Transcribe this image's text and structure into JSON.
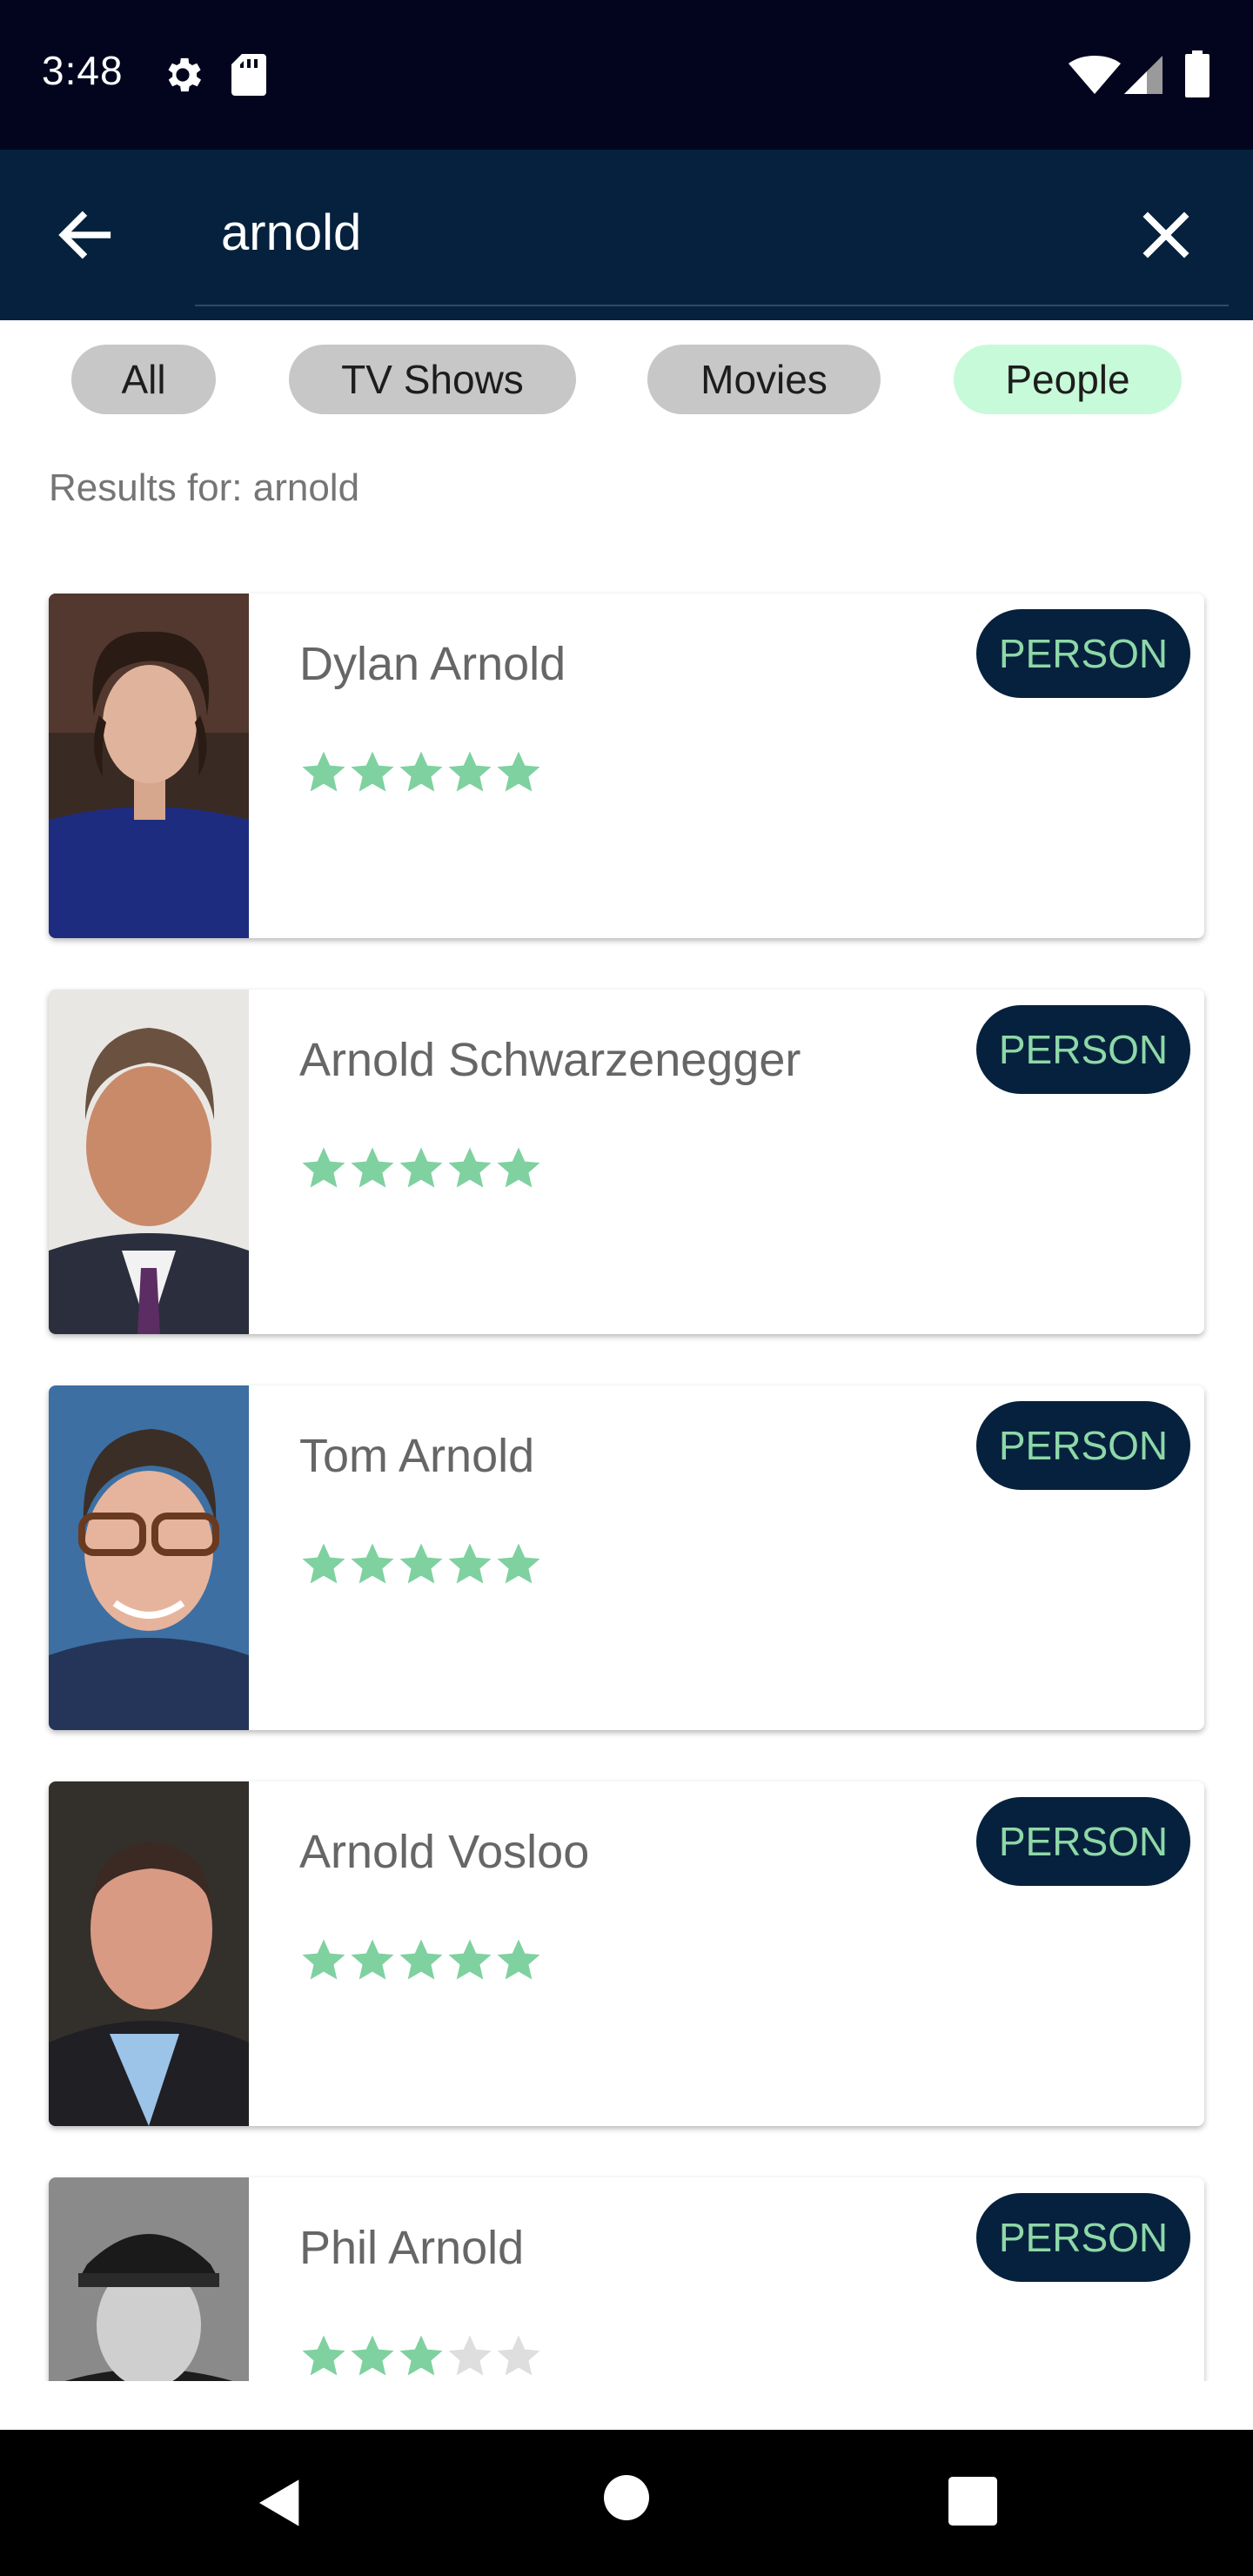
{
  "status_bar": {
    "time": "3:48",
    "icons": [
      "gear-icon",
      "sd-card-icon",
      "wifi-icon",
      "signal-icon",
      "battery-icon"
    ]
  },
  "search": {
    "query": "arnold",
    "back_icon": "arrow-left-icon",
    "clear_icon": "close-icon"
  },
  "filters": [
    {
      "label": "All",
      "active": false
    },
    {
      "label": "TV Shows",
      "active": false
    },
    {
      "label": "Movies",
      "active": false
    },
    {
      "label": "People",
      "active": true
    }
  ],
  "results_label": "Results for: arnold",
  "results": [
    {
      "name": "Dylan Arnold",
      "badge": "PERSON",
      "rating": 5
    },
    {
      "name": "Arnold Schwarzenegger",
      "badge": "PERSON",
      "rating": 5
    },
    {
      "name": "Tom Arnold",
      "badge": "PERSON",
      "rating": 5
    },
    {
      "name": "Arnold Vosloo",
      "badge": "PERSON",
      "rating": 5
    },
    {
      "name": "Phil Arnold",
      "badge": "PERSON",
      "rating": 3
    }
  ],
  "colors": {
    "status_bar": "#03051f",
    "app_bar": "#06213d",
    "chip": "#c7c7c7",
    "chip_active": "#c7fad8",
    "badge_bg": "#06213d",
    "badge_text": "#8ed8a8",
    "star_filled": "#7fd1a0",
    "star_empty": "#dedede"
  },
  "nav_bar": {
    "icons": [
      "nav-back-icon",
      "nav-home-icon",
      "nav-recents-icon"
    ]
  }
}
